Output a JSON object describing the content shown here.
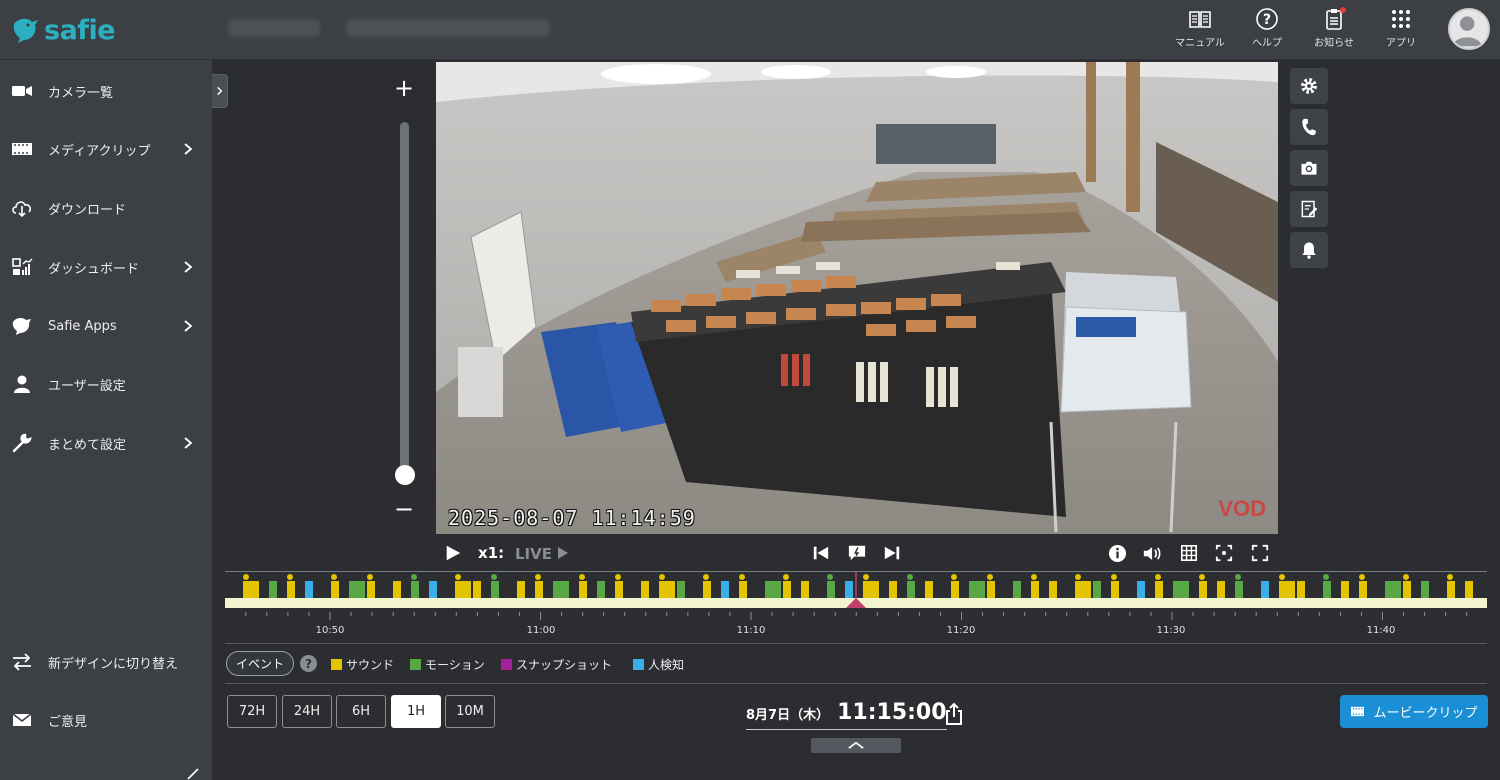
{
  "brand": {
    "name": "safie",
    "color": "#2bb0c2"
  },
  "header": {
    "items": [
      {
        "label": "マニュアル",
        "icon": "book-icon"
      },
      {
        "label": "ヘルプ",
        "icon": "help-icon"
      },
      {
        "label": "お知らせ",
        "icon": "clipboard-icon"
      },
      {
        "label": "アプリ",
        "icon": "grid-icon"
      }
    ],
    "notification_dot_color": "#e83b3b"
  },
  "sidebar": {
    "items": [
      {
        "label": "カメラ一覧",
        "icon": "video-camera-icon",
        "has_submenu": false
      },
      {
        "label": "メディアクリップ",
        "icon": "film-icon",
        "has_submenu": true
      },
      {
        "label": "ダウンロード",
        "icon": "cloud-download-icon",
        "has_submenu": false
      },
      {
        "label": "ダッシュボード",
        "icon": "dashboard-icon",
        "has_submenu": true
      },
      {
        "label": "Safie Apps",
        "icon": "safie-bird-icon",
        "has_submenu": true
      },
      {
        "label": "ユーザー設定",
        "icon": "user-icon",
        "has_submenu": false
      },
      {
        "label": "まとめて設定",
        "icon": "wrench-icon",
        "has_submenu": true
      }
    ],
    "bottom_items": [
      {
        "label": "新デザインに切り替え",
        "icon": "swap-arrows-icon"
      },
      {
        "label": "ご意見",
        "icon": "mail-icon"
      }
    ]
  },
  "video": {
    "timestamp": "2025-08-07  11:14:59",
    "mode_badge": "VOD"
  },
  "player": {
    "speed": "x1:",
    "live": "LIVE"
  },
  "timeline": {
    "ticks": [
      "10:50",
      "11:00",
      "11:10",
      "11:20",
      "11:30",
      "11:40"
    ],
    "colors": {
      "sound": "#e2c400",
      "motion": "#5aa845",
      "snapshot": "#a3209a",
      "person": "#3aaee8",
      "cursor": "#c2416a"
    }
  },
  "legend": {
    "event_button": "イベント",
    "help": "?",
    "items": [
      {
        "label": "サウンド",
        "color": "#e2c400"
      },
      {
        "label": "モーション",
        "color": "#5aa845"
      },
      {
        "label": "スナップショット",
        "color": "#a3209a"
      },
      {
        "label": "人検知",
        "color": "#3aaee8"
      }
    ]
  },
  "ranges": {
    "options": [
      "72H",
      "24H",
      "6H",
      "1H",
      "10M"
    ],
    "selected": "1H"
  },
  "current": {
    "date": "8月7日（木）",
    "time": "11:15:00"
  },
  "movie_clip_button": "ムービークリップ",
  "accent_color": "#1b8fd6"
}
